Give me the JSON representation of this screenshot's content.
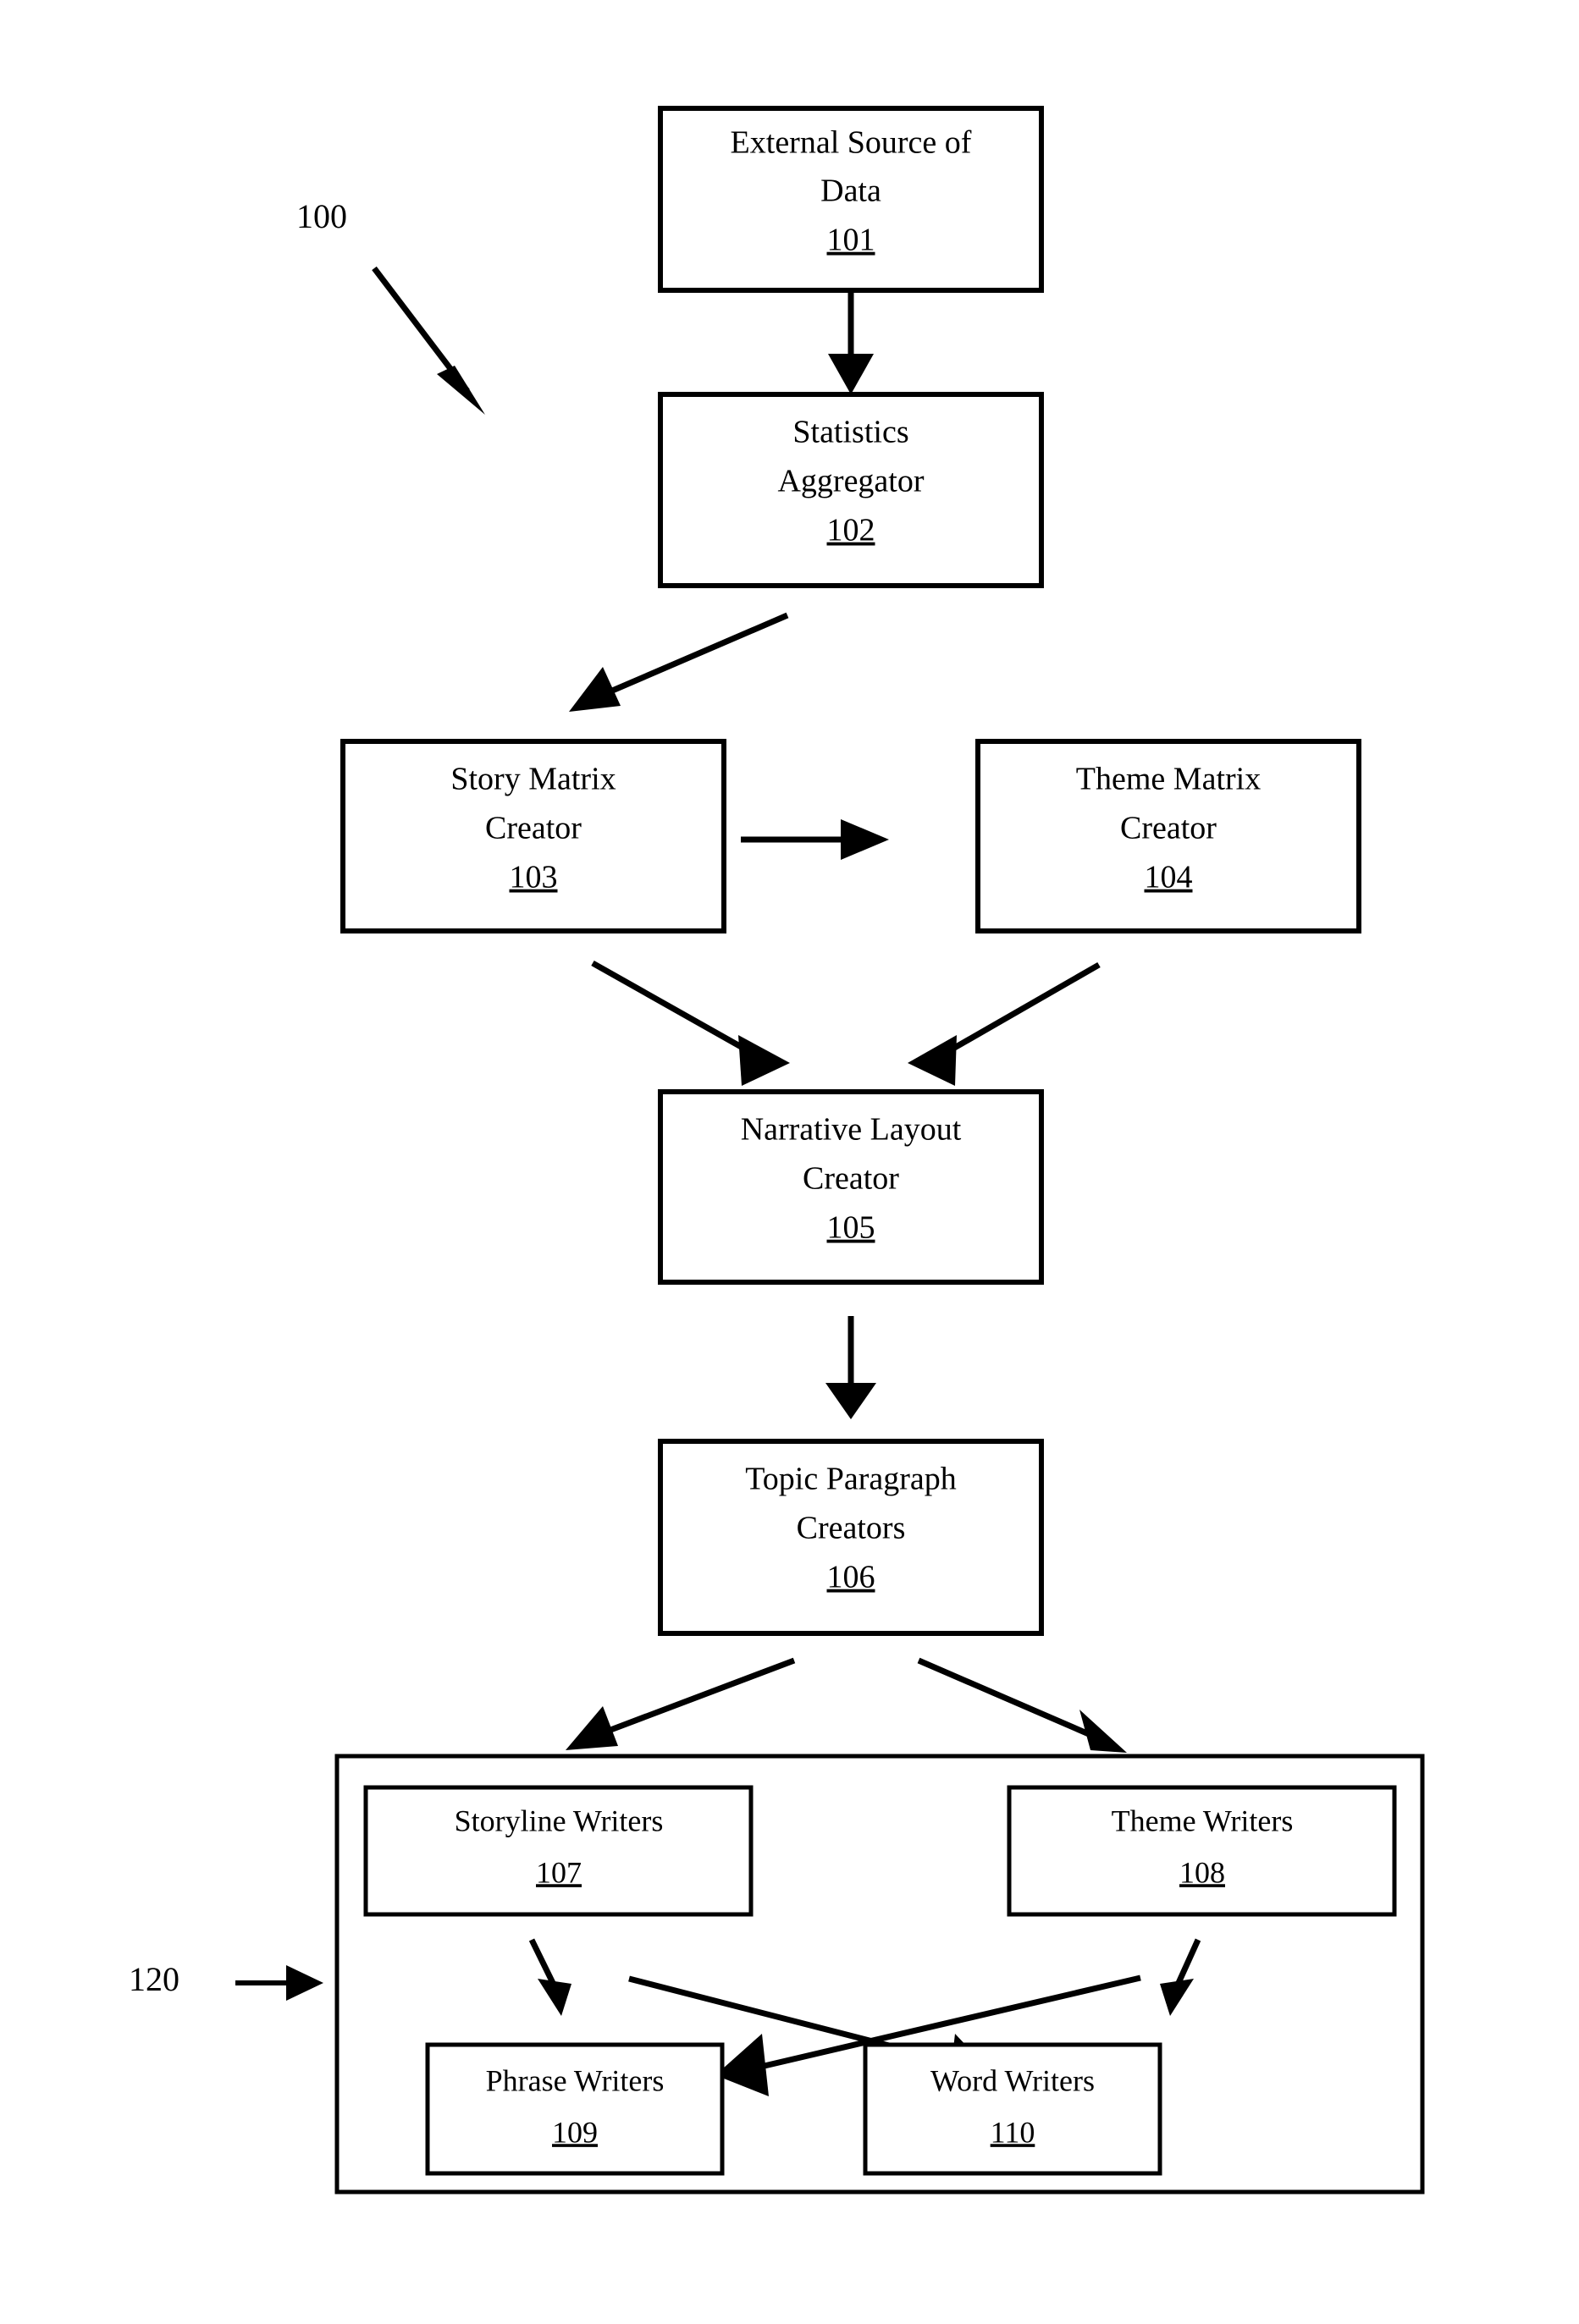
{
  "figure": {
    "title": "System architecture flow diagram",
    "callouts": [
      {
        "id": "callout-100",
        "label": "100"
      },
      {
        "id": "callout-120",
        "label": "120"
      }
    ],
    "nodes": [
      {
        "id": "node-101",
        "name": "external-source-of-data",
        "line1": "External Source of",
        "line2": "Data",
        "ref": "101"
      },
      {
        "id": "node-102",
        "name": "statistics-aggregator",
        "line1": "Statistics",
        "line2": "Aggregator",
        "ref": "102"
      },
      {
        "id": "node-103",
        "name": "story-matrix-creator",
        "line1": "Story Matrix",
        "line2": "Creator",
        "ref": "103"
      },
      {
        "id": "node-104",
        "name": "theme-matrix-creator",
        "line1": "Theme Matrix",
        "line2": "Creator",
        "ref": "104"
      },
      {
        "id": "node-105",
        "name": "narrative-layout-creator",
        "line1": "Narrative Layout",
        "line2": "Creator",
        "ref": "105"
      },
      {
        "id": "node-106",
        "name": "topic-paragraph-creators",
        "line1": "Topic Paragraph",
        "line2": "Creators",
        "ref": "106"
      },
      {
        "id": "node-107",
        "name": "storyline-writers",
        "line1": "Storyline Writers",
        "line2": "",
        "ref": "107"
      },
      {
        "id": "node-108",
        "name": "theme-writers",
        "line1": "Theme Writers",
        "line2": "",
        "ref": "108"
      },
      {
        "id": "node-109",
        "name": "phrase-writers",
        "line1": "Phrase Writers",
        "line2": "",
        "ref": "109"
      },
      {
        "id": "node-110",
        "name": "word-writers",
        "line1": "Word Writers",
        "line2": "",
        "ref": "110"
      }
    ],
    "colors": {
      "stroke": "#000000",
      "fill": "#ffffff",
      "background": "#ffffff"
    }
  }
}
